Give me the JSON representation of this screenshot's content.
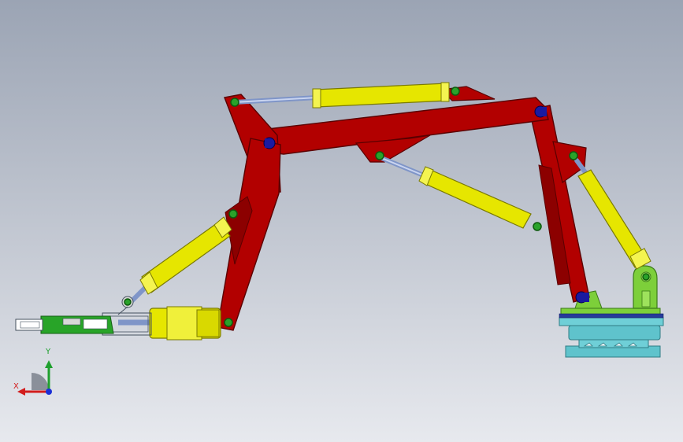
{
  "viewport": {
    "triad": {
      "x_label": "X",
      "y_label": "Y"
    }
  },
  "colors": {
    "background_top": "#9ba4b4",
    "background_bottom": "#e7e9ee",
    "boom": "#a80000",
    "cylinder": "#e6e600",
    "rod": "#7f95c8",
    "pin": "#2aa22a",
    "pin_blue": "#1a1aa0",
    "base_plate": "#5fc3cc",
    "gripper": "#28a428",
    "bracket": "#7dcf3a"
  },
  "icons": {
    "triad": "coordinate-triad-icon"
  }
}
